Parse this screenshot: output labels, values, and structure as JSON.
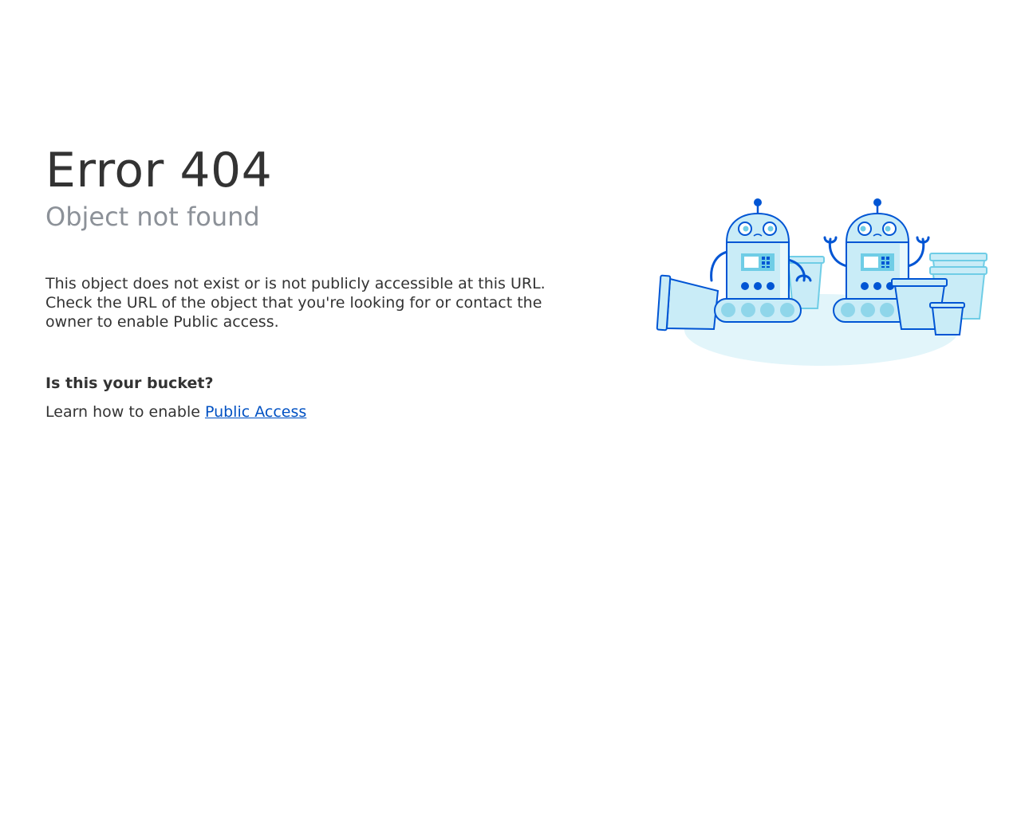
{
  "error": {
    "title": "Error 404",
    "subtitle": "Object not found"
  },
  "description": "This object does not exist or is not publicly accessible at this URL. Check the URL of the object that you're looking for or contact the owner to enable Public access.",
  "bucket": {
    "question": "Is this your bucket?",
    "learn_prefix": "Learn how to enable ",
    "link_label": "Public Access"
  },
  "colors": {
    "title": "#333333",
    "subtitle": "#8c9198",
    "link": "#0051c3",
    "robot_outline": "#0055d4",
    "robot_fill": "#c9ecf7",
    "accent_light": "#e2f5fa"
  },
  "illustration": {
    "name": "robots-with-buckets-illustration"
  }
}
